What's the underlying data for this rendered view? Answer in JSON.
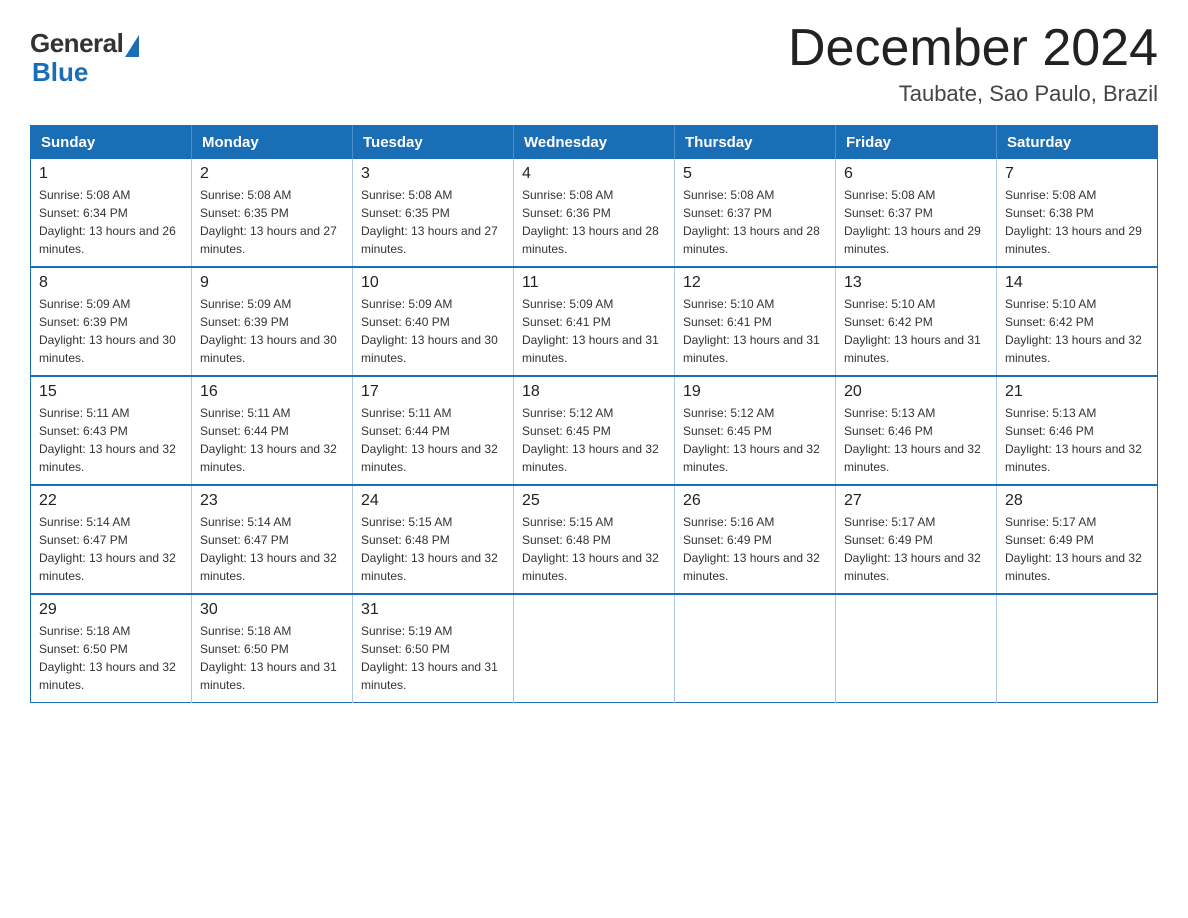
{
  "logo": {
    "general": "General",
    "blue": "Blue"
  },
  "title": "December 2024",
  "subtitle": "Taubate, Sao Paulo, Brazil",
  "days_of_week": [
    "Sunday",
    "Monday",
    "Tuesday",
    "Wednesday",
    "Thursday",
    "Friday",
    "Saturday"
  ],
  "weeks": [
    [
      {
        "day": "1",
        "sunrise": "5:08 AM",
        "sunset": "6:34 PM",
        "daylight": "13 hours and 26 minutes."
      },
      {
        "day": "2",
        "sunrise": "5:08 AM",
        "sunset": "6:35 PM",
        "daylight": "13 hours and 27 minutes."
      },
      {
        "day": "3",
        "sunrise": "5:08 AM",
        "sunset": "6:35 PM",
        "daylight": "13 hours and 27 minutes."
      },
      {
        "day": "4",
        "sunrise": "5:08 AM",
        "sunset": "6:36 PM",
        "daylight": "13 hours and 28 minutes."
      },
      {
        "day": "5",
        "sunrise": "5:08 AM",
        "sunset": "6:37 PM",
        "daylight": "13 hours and 28 minutes."
      },
      {
        "day": "6",
        "sunrise": "5:08 AM",
        "sunset": "6:37 PM",
        "daylight": "13 hours and 29 minutes."
      },
      {
        "day": "7",
        "sunrise": "5:08 AM",
        "sunset": "6:38 PM",
        "daylight": "13 hours and 29 minutes."
      }
    ],
    [
      {
        "day": "8",
        "sunrise": "5:09 AM",
        "sunset": "6:39 PM",
        "daylight": "13 hours and 30 minutes."
      },
      {
        "day": "9",
        "sunrise": "5:09 AM",
        "sunset": "6:39 PM",
        "daylight": "13 hours and 30 minutes."
      },
      {
        "day": "10",
        "sunrise": "5:09 AM",
        "sunset": "6:40 PM",
        "daylight": "13 hours and 30 minutes."
      },
      {
        "day": "11",
        "sunrise": "5:09 AM",
        "sunset": "6:41 PM",
        "daylight": "13 hours and 31 minutes."
      },
      {
        "day": "12",
        "sunrise": "5:10 AM",
        "sunset": "6:41 PM",
        "daylight": "13 hours and 31 minutes."
      },
      {
        "day": "13",
        "sunrise": "5:10 AM",
        "sunset": "6:42 PM",
        "daylight": "13 hours and 31 minutes."
      },
      {
        "day": "14",
        "sunrise": "5:10 AM",
        "sunset": "6:42 PM",
        "daylight": "13 hours and 32 minutes."
      }
    ],
    [
      {
        "day": "15",
        "sunrise": "5:11 AM",
        "sunset": "6:43 PM",
        "daylight": "13 hours and 32 minutes."
      },
      {
        "day": "16",
        "sunrise": "5:11 AM",
        "sunset": "6:44 PM",
        "daylight": "13 hours and 32 minutes."
      },
      {
        "day": "17",
        "sunrise": "5:11 AM",
        "sunset": "6:44 PM",
        "daylight": "13 hours and 32 minutes."
      },
      {
        "day": "18",
        "sunrise": "5:12 AM",
        "sunset": "6:45 PM",
        "daylight": "13 hours and 32 minutes."
      },
      {
        "day": "19",
        "sunrise": "5:12 AM",
        "sunset": "6:45 PM",
        "daylight": "13 hours and 32 minutes."
      },
      {
        "day": "20",
        "sunrise": "5:13 AM",
        "sunset": "6:46 PM",
        "daylight": "13 hours and 32 minutes."
      },
      {
        "day": "21",
        "sunrise": "5:13 AM",
        "sunset": "6:46 PM",
        "daylight": "13 hours and 32 minutes."
      }
    ],
    [
      {
        "day": "22",
        "sunrise": "5:14 AM",
        "sunset": "6:47 PM",
        "daylight": "13 hours and 32 minutes."
      },
      {
        "day": "23",
        "sunrise": "5:14 AM",
        "sunset": "6:47 PM",
        "daylight": "13 hours and 32 minutes."
      },
      {
        "day": "24",
        "sunrise": "5:15 AM",
        "sunset": "6:48 PM",
        "daylight": "13 hours and 32 minutes."
      },
      {
        "day": "25",
        "sunrise": "5:15 AM",
        "sunset": "6:48 PM",
        "daylight": "13 hours and 32 minutes."
      },
      {
        "day": "26",
        "sunrise": "5:16 AM",
        "sunset": "6:49 PM",
        "daylight": "13 hours and 32 minutes."
      },
      {
        "day": "27",
        "sunrise": "5:17 AM",
        "sunset": "6:49 PM",
        "daylight": "13 hours and 32 minutes."
      },
      {
        "day": "28",
        "sunrise": "5:17 AM",
        "sunset": "6:49 PM",
        "daylight": "13 hours and 32 minutes."
      }
    ],
    [
      {
        "day": "29",
        "sunrise": "5:18 AM",
        "sunset": "6:50 PM",
        "daylight": "13 hours and 32 minutes."
      },
      {
        "day": "30",
        "sunrise": "5:18 AM",
        "sunset": "6:50 PM",
        "daylight": "13 hours and 31 minutes."
      },
      {
        "day": "31",
        "sunrise": "5:19 AM",
        "sunset": "6:50 PM",
        "daylight": "13 hours and 31 minutes."
      },
      null,
      null,
      null,
      null
    ]
  ]
}
